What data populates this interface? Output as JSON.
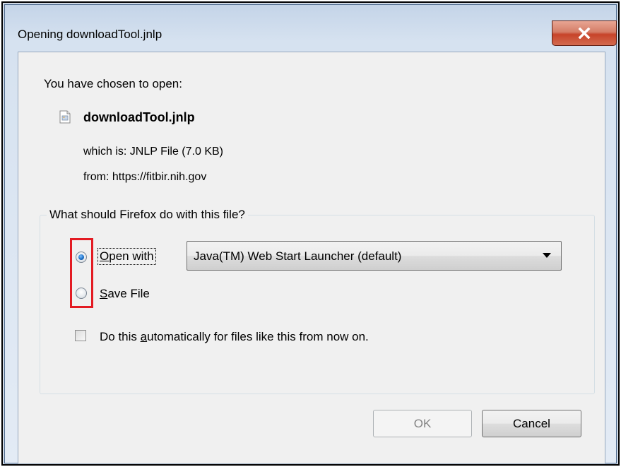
{
  "window": {
    "title": "Opening downloadTool.jnlp",
    "close_icon": "close-icon"
  },
  "dialog": {
    "lead": "You have chosen to open:",
    "file": {
      "icon": "jnlp-file-icon",
      "name": "downloadTool.jnlp",
      "type_line": "which is: JNLP File (7.0 KB)",
      "from_label": "from:",
      "from_url": "https://fitbir.nih.gov"
    },
    "action_group": {
      "legend": "What should Firefox do with this file?",
      "open_with": {
        "mnemonic": "O",
        "rest": "pen with",
        "checked": true
      },
      "save_file": {
        "mnemonic": "S",
        "rest": "ave File",
        "checked": false
      },
      "app_select": {
        "selected": "Java(TM) Web Start Launcher (default)"
      },
      "auto_checkbox": {
        "pre": "Do this ",
        "mnemonic": "a",
        "post": "utomatically for files like this from now on.",
        "checked": false
      }
    },
    "buttons": {
      "ok": "OK",
      "cancel": "Cancel"
    }
  },
  "colors": {
    "highlight_border": "#e31b23",
    "client_bg": "#f0f0f0",
    "disabled_text": "#838383"
  }
}
